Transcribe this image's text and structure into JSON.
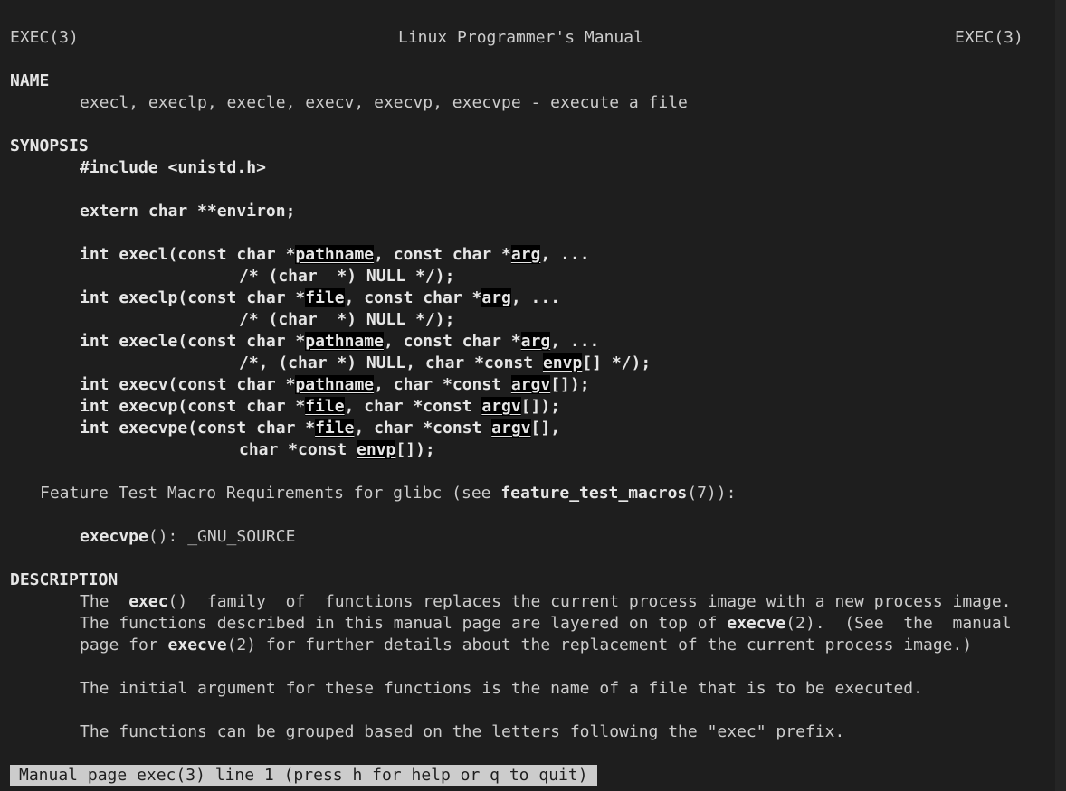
{
  "header": {
    "left": "EXEC(3)",
    "center": "Linux Programmer's Manual",
    "right": "EXEC(3)"
  },
  "name_section": {
    "heading": "NAME",
    "text": "execl, execlp, execle, execv, execvp, execvpe - execute a file"
  },
  "synopsis": {
    "heading": "SYNOPSIS",
    "include": "#include <unistd.h>",
    "environ": "extern char **environ;",
    "protos": {
      "execl_a": "int execl(const char *",
      "execl_p1": "pathname",
      "execl_b": ", const char *",
      "execl_p2": "arg",
      "execl_c": ", ...",
      "execl_cont": "/* (char  *) NULL */);",
      "execlp_a": "int execlp(const char *",
      "execlp_p1": "file",
      "execlp_b": ", const char *",
      "execlp_p2": "arg",
      "execlp_c": ", ...",
      "execlp_cont": "/* (char  *) NULL */);",
      "execle_a": "int execle(const char *",
      "execle_p1": "pathname",
      "execle_b": ", const char *",
      "execle_p2": "arg",
      "execle_c": ", ...",
      "execle_cont_a": "/*, (char *) NULL, char *const ",
      "execle_cont_p": "envp",
      "execle_cont_b": "[] */);",
      "execv_a": "int execv(const char *",
      "execv_p1": "pathname",
      "execv_b": ", char *const ",
      "execv_p2": "argv",
      "execv_c": "[]);",
      "execvp_a": "int execvp(const char *",
      "execvp_p1": "file",
      "execvp_b": ", char *const ",
      "execvp_p2": "argv",
      "execvp_c": "[]);",
      "execvpe_a": "int execvpe(const char *",
      "execvpe_p1": "file",
      "execvpe_b": ", char *const ",
      "execvpe_p2": "argv",
      "execvpe_c": "[],",
      "execvpe_cont_a": "char *const ",
      "execvpe_cont_p": "envp",
      "execvpe_cont_b": "[]);"
    }
  },
  "feature_test": {
    "prefix": "Feature Test Macro Requirements for glibc (see ",
    "link": "feature_test_macros",
    "suffix": "(7)):",
    "req_func": "execvpe",
    "req_text": "(): _GNU_SOURCE"
  },
  "description": {
    "heading": "DESCRIPTION",
    "p1_l1_a": "The  ",
    "p1_l1_b": "exec",
    "p1_l1_c": "()  family  of  functions replaces the current process image with a new process image.",
    "p1_l2_a": "The functions described in this manual page are layered on top of ",
    "p1_l2_b": "execve",
    "p1_l2_c": "(2).  (See  the  manual",
    "p1_l3_a": "page for ",
    "p1_l3_b": "execve",
    "p1_l3_c": "(2) for further details about the replacement of the current process image.)",
    "p2": "The initial argument for these functions is the name of a file that is to be executed.",
    "p3": "The functions can be grouped based on the letters following the \"exec\" prefix."
  },
  "status_bar": {
    "text": "Manual page exec(3) line 1 (press h for help or q to quit)"
  }
}
